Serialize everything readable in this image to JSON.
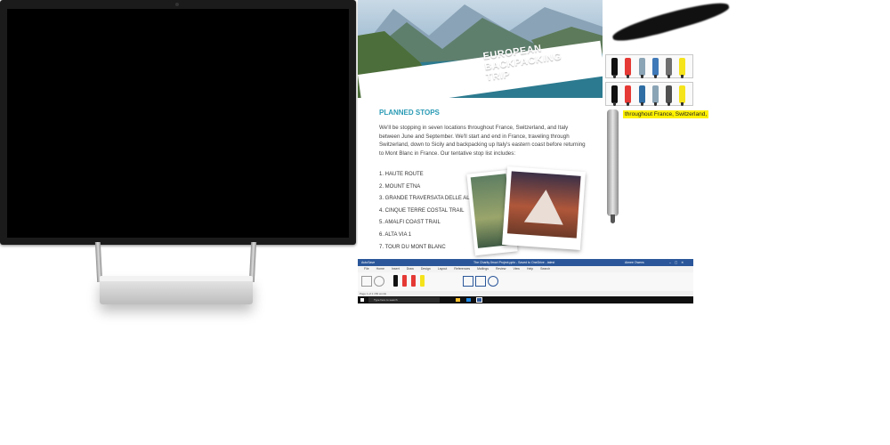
{
  "document": {
    "hero_title_lines": [
      "EUROPEAN",
      "BACKPACKING",
      "TRIP"
    ],
    "section_title": "PLANNED STOPS",
    "paragraph": "We'll be stopping in seven locations throughout France, Switzerland, and Italy between June and September. We'll start and end in France, traveling through Switzerland, down to Sicily and backpacking up Italy's eastern coast before returning to Mont Blanc in France. Our tentative stop list includes:",
    "stops": [
      "1. HAUTE ROUTE",
      "2. MOUNT ETNA",
      "3. GRANDE TRAVERSATA DELLE ALPI",
      "4. CINQUE TERRE COSTAL TRAIL",
      "5. AMALFI COAST TRAIL",
      "6. ALTA VIA 1",
      "7. TOUR DU MONT BLANC"
    ]
  },
  "highlight_text": "throughout France, Switzerland,",
  "word": {
    "autosave": "AutoSave",
    "title": "The Charity Ilmori Project.pptx - Saved to OneDrive - latest",
    "user": "Aimee Owens",
    "tabs": [
      "File",
      "Home",
      "Insert",
      "Draw",
      "Design",
      "Layout",
      "References",
      "Mailings",
      "Review",
      "View",
      "Help"
    ],
    "search_hint": "Search",
    "status_left": "Page 1 of 1    156 words",
    "taskbar_search": "Type here to search"
  },
  "colors": {
    "accent": "#2b9bb5",
    "word_blue": "#2b579a",
    "highlight": "#fff200"
  },
  "pens_row1": [
    "#111111",
    "#e53935",
    "#8aa4b5",
    "#3f79b8",
    "#6f6f6f",
    "#f5e31c"
  ],
  "pens_row2": [
    "#111111",
    "#e53935",
    "#2e6da4",
    "#8aa4b5",
    "#4f4f4f",
    "#f5e31c"
  ]
}
